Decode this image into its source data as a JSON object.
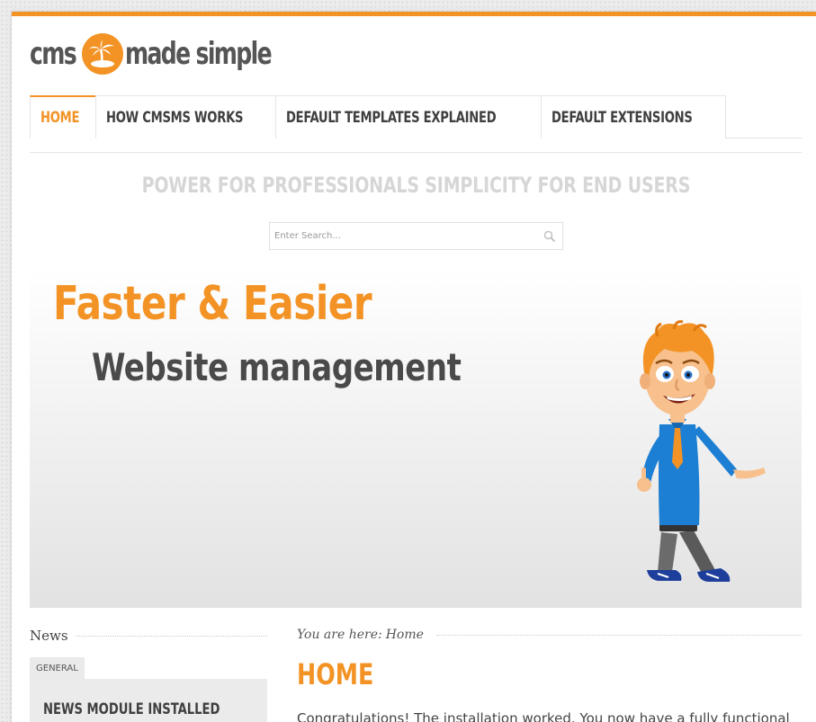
{
  "brand": {
    "logo_left": "cms",
    "logo_right": "made simple",
    "accent_color": "#f39325"
  },
  "nav": {
    "items": [
      {
        "label": "HOME",
        "active": true
      },
      {
        "label": "HOW CMSMS WORKS",
        "active": false
      },
      {
        "label": "DEFAULT TEMPLATES EXPLAINED",
        "active": false
      },
      {
        "label": "DEFAULT EXTENSIONS",
        "active": false
      }
    ]
  },
  "tagline": "POWER FOR PROFESSIONALS SIMPLICITY FOR END USERS",
  "search": {
    "placeholder": "Enter Search...",
    "icon": "search-icon"
  },
  "banner": {
    "headline": "Faster & Easier",
    "subheadline": "Website management",
    "illustration": "cartoon-man"
  },
  "sidebar": {
    "title": "News",
    "category_tab": "GENERAL",
    "item_title": "NEWS MODULE INSTALLED"
  },
  "main": {
    "breadcrumb_label": "You are here:",
    "breadcrumb_current": "Home",
    "title": "HOME",
    "intro": "Congratulations! The installation worked. You now have a fully functional"
  }
}
